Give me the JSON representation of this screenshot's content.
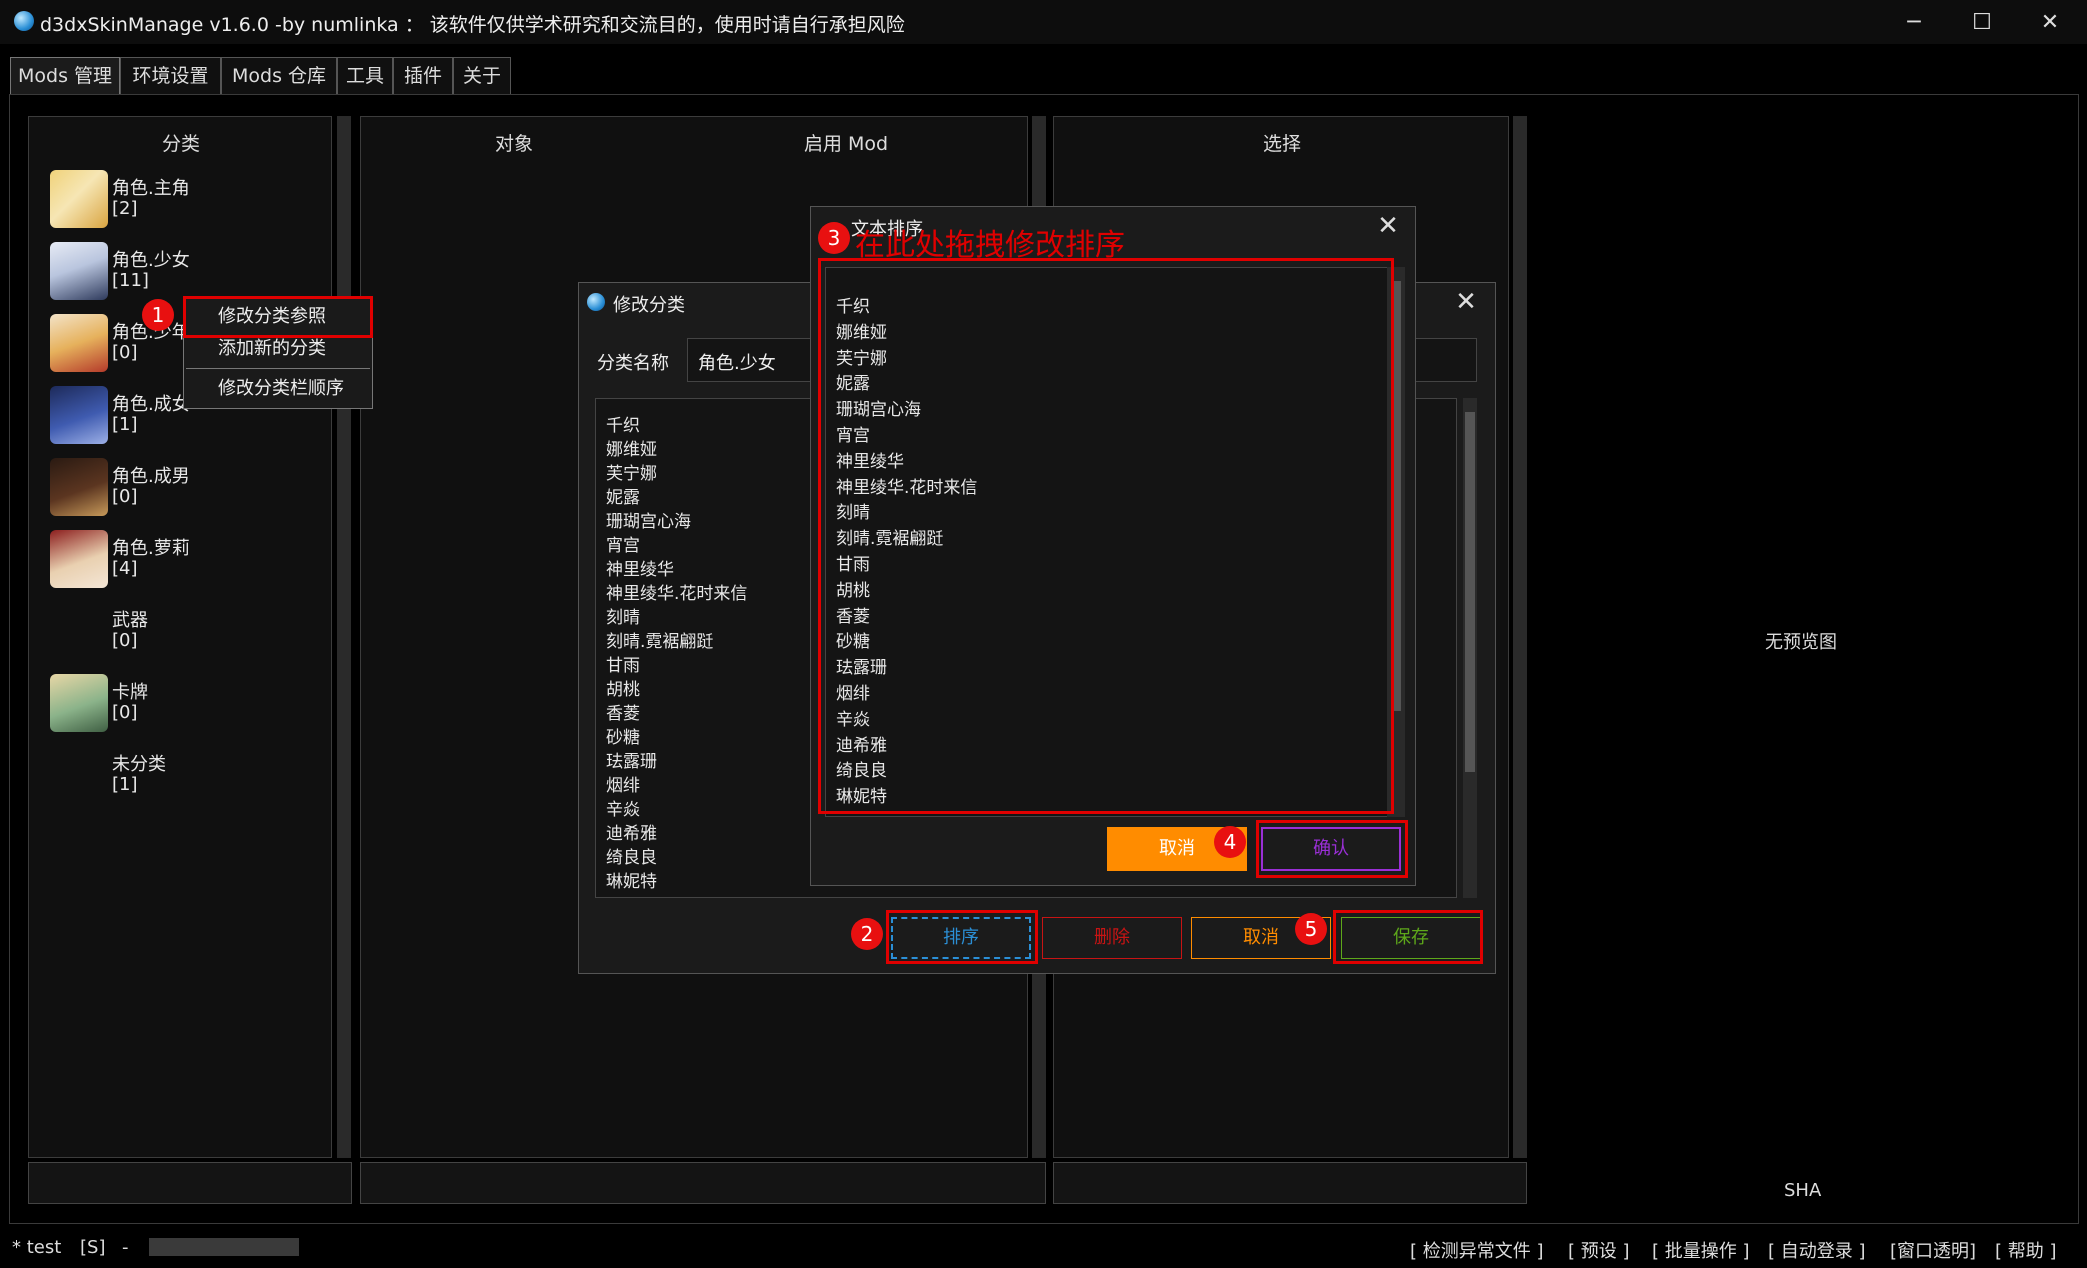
{
  "window": {
    "title": "d3dxSkinManage v1.6.0 -by numlinka ： 该软件仅供学术研究和交流目的，使用时请自行承担风险",
    "controls": {
      "minimize": "─",
      "maximize": "☐",
      "close": "✕"
    }
  },
  "tabs": [
    "Mods 管理",
    "环境设置",
    "Mods 仓库",
    "工具",
    "插件",
    "关于"
  ],
  "panels": {
    "category_header": "分类",
    "object_header": "对象",
    "enabled_header": "启用 Mod",
    "select_header": "选择",
    "no_preview": "无预览图",
    "sha_label": "SHA"
  },
  "categories": [
    {
      "name": "角色.主角",
      "count": "[2]",
      "avatar": "traveler-avatar"
    },
    {
      "name": "角色.少女",
      "count": "[11]",
      "avatar": "girl-avatar"
    },
    {
      "name": "角色.少年",
      "count": "[0]",
      "avatar": "boy-avatar"
    },
    {
      "name": "角色.成女",
      "count": "[1]",
      "avatar": "woman-avatar"
    },
    {
      "name": "角色.成男",
      "count": "[0]",
      "avatar": "man-avatar"
    },
    {
      "name": "角色.萝莉",
      "count": "[4]",
      "avatar": "loli-avatar"
    },
    {
      "name": "武器",
      "count": "[0]",
      "avatar": ""
    },
    {
      "name": "卡牌",
      "count": "[0]",
      "avatar": "card-avatar"
    },
    {
      "name": "未分类",
      "count": "[1]",
      "avatar": ""
    }
  ],
  "context_menu": [
    "修改分类参照",
    "添加新的分类",
    "修改分类栏顺序"
  ],
  "edit_dialog": {
    "title": "修改分类",
    "name_label": "分类名称",
    "name_value": "角色.少女",
    "buttons": {
      "sort": "排序",
      "delete": "删除",
      "cancel": "取消",
      "save": "保存"
    }
  },
  "sort_dialog": {
    "title": "文本排序",
    "buttons": {
      "cancel": "取消",
      "confirm": "确认"
    }
  },
  "character_list": [
    "千织",
    "娜维娅",
    "芙宁娜",
    "妮露",
    "珊瑚宫心海",
    "宵宫",
    "神里绫华",
    "神里绫华.花时来信",
    "刻晴",
    "刻晴.霓裾翩跹",
    "甘雨",
    "胡桃",
    "香菱",
    "砂糖",
    "珐露珊",
    "烟绯",
    "辛焱",
    "迪希雅",
    "绮良良",
    "琳妮特"
  ],
  "annotations": {
    "badges": [
      "1",
      "2",
      "3",
      "4",
      "5"
    ],
    "drag_hint": "在此处拖拽修改排序"
  },
  "statusbar": {
    "left": "* test",
    "mode": "[S]",
    "dash": "-",
    "actions": [
      "[ 检测异常文件 ]",
      "[ 预设 ]",
      "[ 批量操作 ]",
      "[ 自动登录 ]",
      "[窗口透明]",
      "[ 帮助 ]"
    ]
  },
  "colors": {
    "annotation_red": "#e00000",
    "orange": "#ff8c00",
    "confirm_purple": "#9a2fd6",
    "sort_blue": "#2b8fd6",
    "save_green": "#5ea81a",
    "delete_red": "#c81414"
  }
}
